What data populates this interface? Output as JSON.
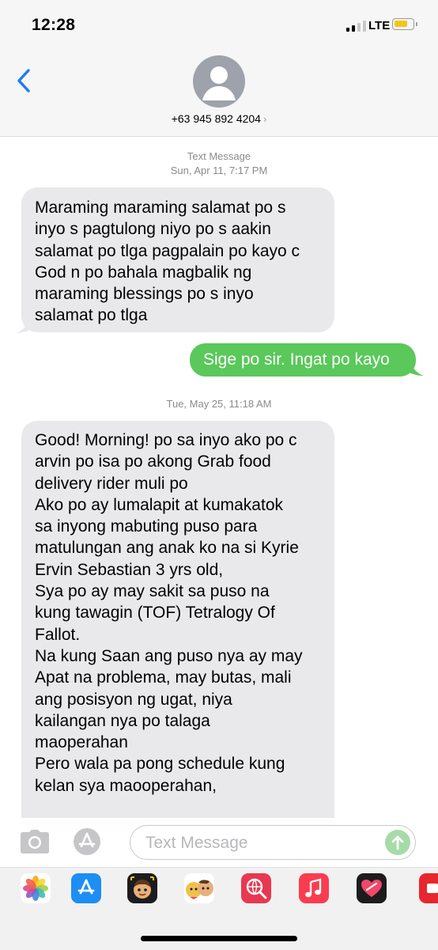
{
  "status_bar": {
    "time": "12:28",
    "network": "LTE"
  },
  "header": {
    "contact": "+63 945 892 4204"
  },
  "conversation": {
    "thread1_service": "Text Message",
    "thread1_timestamp": "Sun, Apr 11, 7:17 PM",
    "message1": "Maraming maraming salamat po s\ninyo s pagtulong niyo po s aakin\nsalamat po tlga pagpalain po kayo c\nGod n po bahala magbalik ng\nmaraming blessings po s inyo\nsalamat po tlga",
    "message2": "Sige po sir. Ingat po kayo",
    "thread2_timestamp": "Tue, May 25, 11:18 AM",
    "message3": "Good! Morning! po sa inyo ako po c\narvin po isa po akong Grab food\ndelivery rider muli po\nAko po ay lumalapit at kumakatok\nsa inyong mabuting puso para\nmatulungan ang anak ko na si Kyrie\nErvin Sebastian 3 yrs old,\nSya po ay may sakit sa puso na\nkung tawagin (TOF) Tetralogy Of\nFallot.\nNa kung Saan ang puso nya ay may\nApat na problema, may butas, mali\nang posisyon ng ugat, niya\nkailangan nya po talaga\nmaoperahan\nPero wala pa pong schedule kung\nkelan sya maooperahan,"
  },
  "composer": {
    "placeholder": "Text Message"
  },
  "app_strip": {
    "apps": [
      "photos-app",
      "app-store-app",
      "memoji-app",
      "animoji-app",
      "search-images-app",
      "music-app",
      "heart-app"
    ]
  },
  "colors": {
    "incoming_bubble": "#e9e9eb",
    "outgoing_bubble": "#5ac85a",
    "accent_blue": "#1a7cf5",
    "header_bg": "#f6f6f6"
  }
}
